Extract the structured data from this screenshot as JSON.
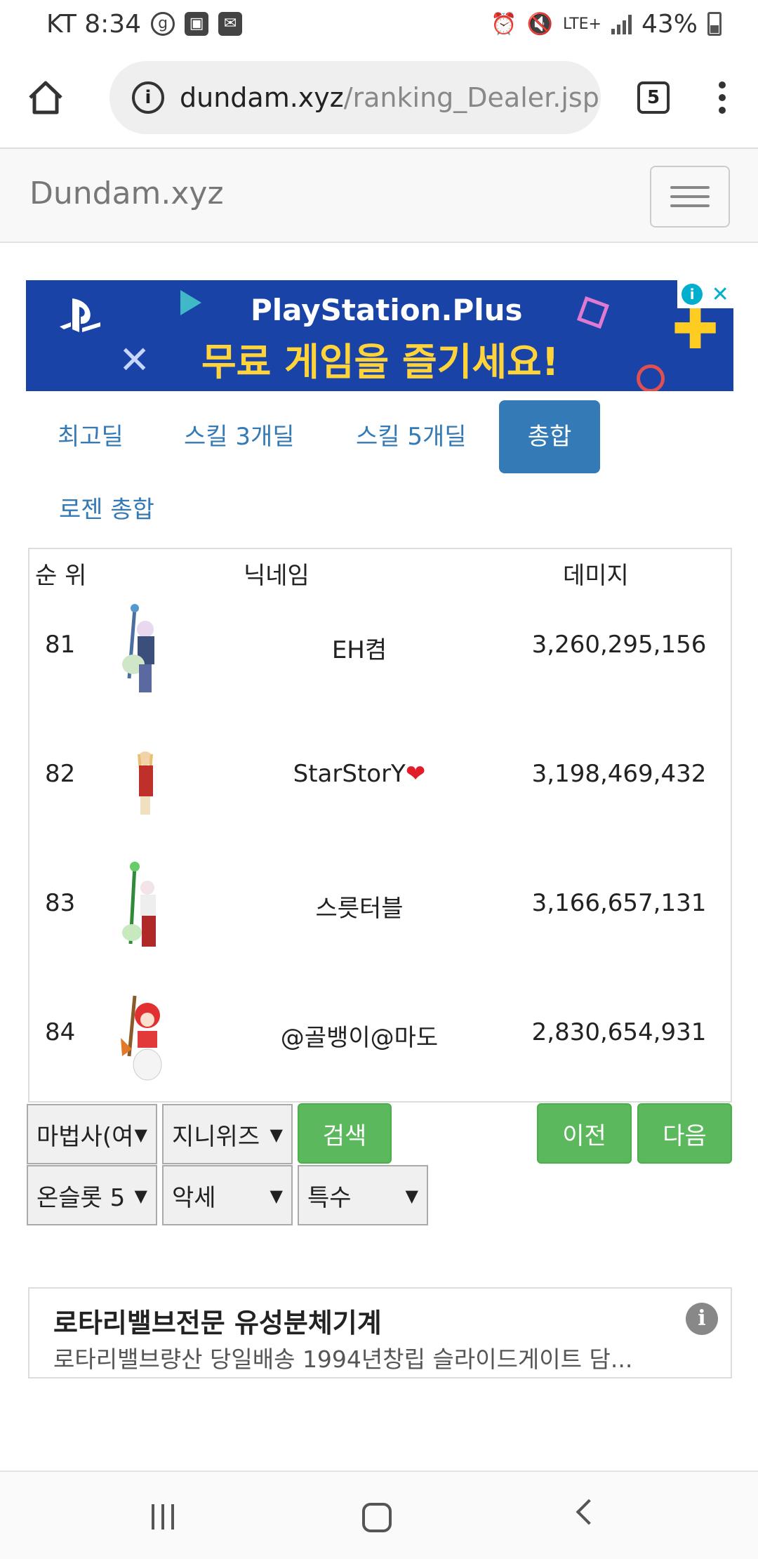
{
  "status_bar": {
    "carrier_time": "KT 8:34",
    "network": "LTE+",
    "battery": "43%"
  },
  "browser": {
    "url_host": "dundam.xyz",
    "url_path": "/ranking_Dealer.jsp",
    "tab_count": "5"
  },
  "navbar": {
    "brand": "Dundam.xyz"
  },
  "ad_banner": {
    "title": "PlayStation.Plus",
    "subtitle": "무료 게임을 즐기세요!"
  },
  "tabs": [
    {
      "label": "최고딜",
      "active": false
    },
    {
      "label": "스킬 3개딜",
      "active": false
    },
    {
      "label": "스킬 5개딜",
      "active": false
    },
    {
      "label": "총합",
      "active": true
    },
    {
      "label": "로젠 총합",
      "active": false
    }
  ],
  "table": {
    "headers": [
      "순 위",
      "닉네임",
      "데미지"
    ],
    "rows": [
      {
        "rank": "81",
        "nickname": "EH켬",
        "damage": "3,260,295,156"
      },
      {
        "rank": "82",
        "nickname": "StarStorY",
        "heart": "❤",
        "damage": "3,198,469,432"
      },
      {
        "rank": "83",
        "nickname": "스릇터블",
        "damage": "3,166,657,131"
      },
      {
        "rank": "84",
        "nickname": "@골뱅이@마도",
        "damage": "2,830,654,931"
      }
    ]
  },
  "controls": {
    "class_select": "마법사(여",
    "job_select": "지니위즈",
    "search_button": "검색",
    "prev_button": "이전",
    "next_button": "다음",
    "set_select": "온슬롯 5",
    "option_select": "악세",
    "type_select": "특수",
    "arrow": "▼"
  },
  "text_ad": {
    "title": "로타리밸브전문 유성분체기계",
    "description": "로타리밸브량산 당일배송 1994년창립 슬라이드게이트 담..."
  }
}
